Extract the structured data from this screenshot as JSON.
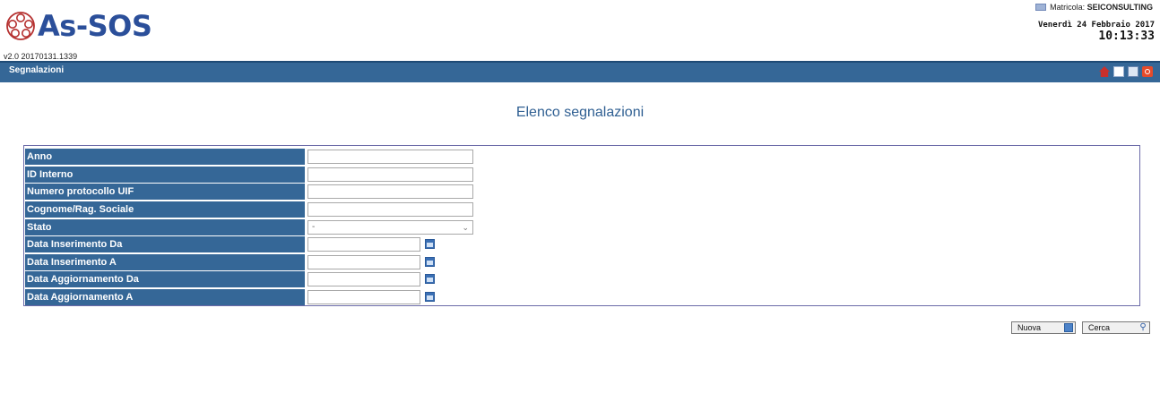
{
  "app": {
    "brand": "As-SOS",
    "version": "v2.0 20170131.1339"
  },
  "user": {
    "label": "Matricola:",
    "id": "SEICONSULTING"
  },
  "datetime": {
    "date": "Venerdì 24 Febbraio 2017",
    "time": "10:13:33"
  },
  "topbar": {
    "title": "Segnalazioni",
    "icons": [
      "home-icon",
      "panel-icon",
      "window-icon",
      "power-icon"
    ]
  },
  "page": {
    "title": "Elenco segnalazioni"
  },
  "form": {
    "fields": [
      {
        "label": "Anno",
        "value": ""
      },
      {
        "label": "ID Interno",
        "value": ""
      },
      {
        "label": "Numero protocollo UIF",
        "value": ""
      },
      {
        "label": "Cognome/Rag. Sociale",
        "value": ""
      },
      {
        "label": "Stato",
        "value": "-"
      },
      {
        "label": "Data Inserimento Da",
        "value": ""
      },
      {
        "label": "Data Inserimento A",
        "value": ""
      },
      {
        "label": "Data Aggiornamento Da",
        "value": ""
      },
      {
        "label": "Data Aggiornamento A",
        "value": ""
      }
    ]
  },
  "buttons": {
    "new": "Nuova",
    "search": "Cerca"
  },
  "colors": {
    "bar": "#356797",
    "brand": "#2b4f9a",
    "title": "#2f5f92"
  }
}
